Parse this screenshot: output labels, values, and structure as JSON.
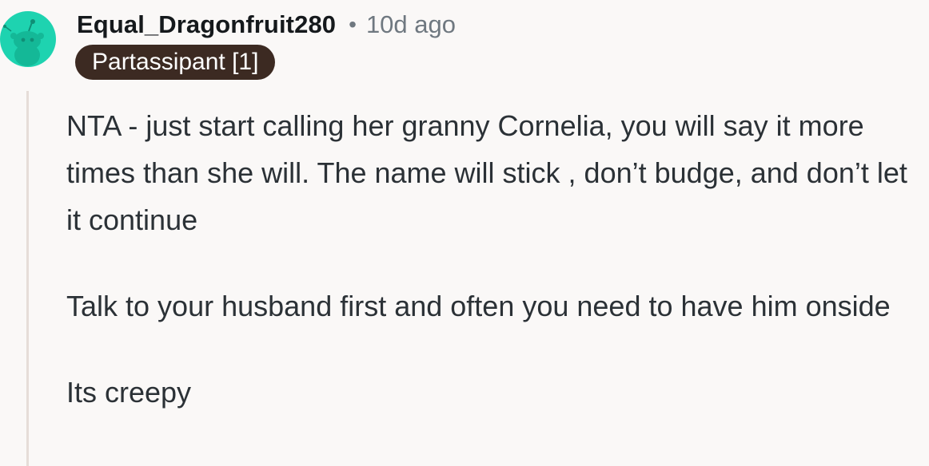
{
  "comment": {
    "username": "Equal_Dragonfruit280",
    "separator": "•",
    "timestamp": "10d ago",
    "flair": "Partassipant [1]",
    "avatar_icon": "reddit-snoo-avatar-icon",
    "avatar_color": "#1ed3b0",
    "paragraphs": [
      "NTA - just start calling her granny Cornelia, you will say it more times than she will. The name will stick , don’t budge, and don’t let it continue",
      "Talk to your husband first and often you need to have him onside",
      "Its creepy"
    ]
  },
  "colors": {
    "background": "#faf8f7",
    "flair_background": "#3c2a22",
    "thread_line": "#e6ddd8",
    "meta_text": "#6f7880"
  }
}
